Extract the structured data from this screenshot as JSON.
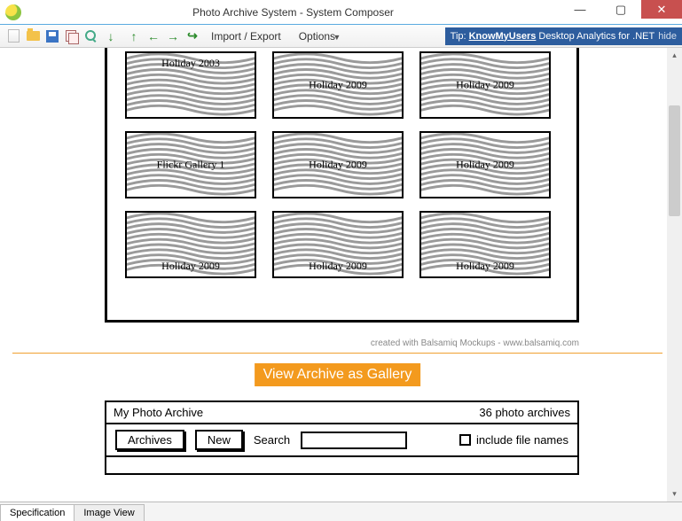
{
  "window": {
    "title": "Photo Archive System - System Composer"
  },
  "toolbar": {
    "import_export": "Import / Export",
    "options": "Options",
    "tip_prefix": "Tip:",
    "tip_link": "KnowMyUsers",
    "tip_suffix": "Desktop Analytics for .NET",
    "tip_hide": "hide"
  },
  "gallery": {
    "cards": [
      {
        "label": "Holiday 2003",
        "pos": "top"
      },
      {
        "label": "Holiday 2009",
        "pos": "mid"
      },
      {
        "label": "Holiday 2009",
        "pos": "mid"
      },
      {
        "label": "Flickr Gallery 1",
        "pos": "mid"
      },
      {
        "label": "Holiday 2009",
        "pos": "mid"
      },
      {
        "label": "Holiday 2009",
        "pos": "mid"
      },
      {
        "label": "Holiday 2009",
        "pos": "bot"
      },
      {
        "label": "Holiday 2009",
        "pos": "bot"
      },
      {
        "label": "Holiday 2009",
        "pos": "bot"
      }
    ],
    "credit": "created with Balsamiq Mockups - www.balsamiq.com",
    "view_button": "View Archive as Gallery"
  },
  "archive": {
    "title": "My Photo Archive",
    "count": "36 photo archives",
    "archives_btn": "Archives",
    "new_btn": "New",
    "search_label": "Search",
    "include_label": "include file names"
  },
  "tabs": {
    "spec": "Specification",
    "image": "Image View"
  }
}
